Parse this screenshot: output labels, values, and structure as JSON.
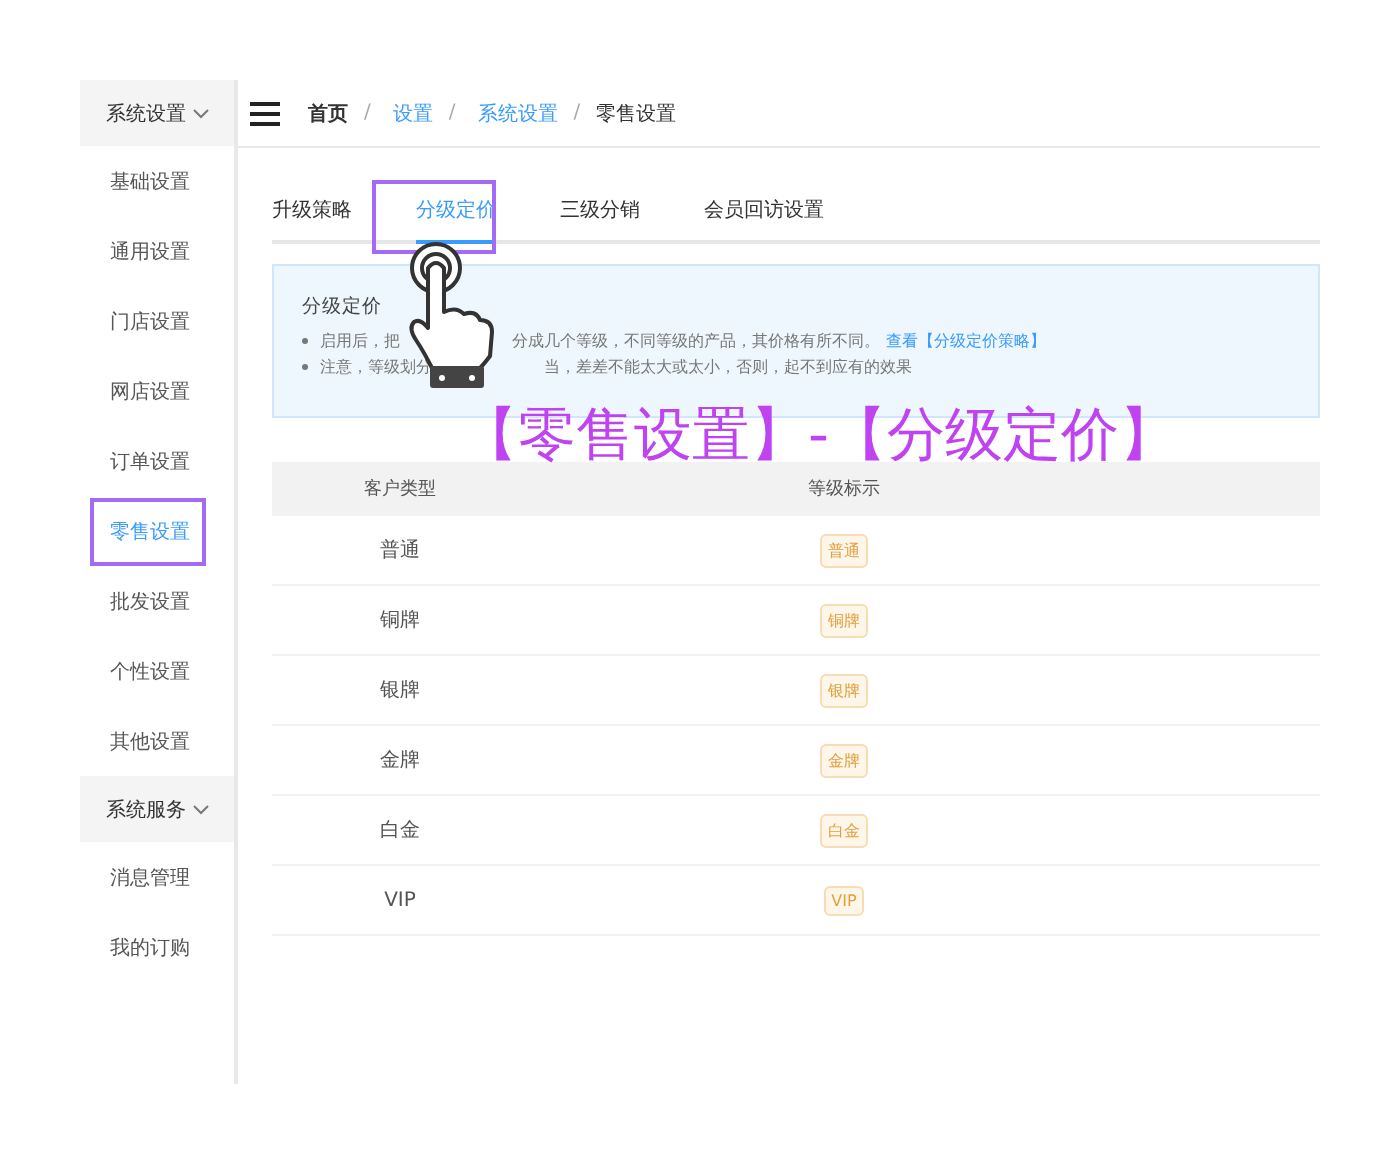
{
  "sidebar": {
    "groups": [
      {
        "title": "系统设置",
        "expanded": true,
        "items": [
          {
            "label": "基础设置",
            "selected": false
          },
          {
            "label": "通用设置",
            "selected": false
          },
          {
            "label": "门店设置",
            "selected": false
          },
          {
            "label": "网店设置",
            "selected": false
          },
          {
            "label": "订单设置",
            "selected": false
          },
          {
            "label": "零售设置",
            "selected": true
          },
          {
            "label": "批发设置",
            "selected": false
          },
          {
            "label": "个性设置",
            "selected": false
          },
          {
            "label": "其他设置",
            "selected": false
          }
        ]
      },
      {
        "title": "系统服务",
        "expanded": true,
        "items": [
          {
            "label": "消息管理",
            "selected": false
          },
          {
            "label": "我的订购",
            "selected": false
          }
        ]
      }
    ]
  },
  "breadcrumb": [
    {
      "label": "首页",
      "kind": "home"
    },
    {
      "separator": "/",
      "label": "设置",
      "kind": "link"
    },
    {
      "separator": "/",
      "label": "系统设置",
      "kind": "link"
    },
    {
      "separator": "/",
      "label": "零售设置",
      "kind": "current"
    }
  ],
  "tabs": [
    {
      "label": "升级策略",
      "selected": false
    },
    {
      "label": "分级定价",
      "selected": true
    },
    {
      "label": "三级分销",
      "selected": false
    },
    {
      "label": "会员回访设置",
      "selected": false
    }
  ],
  "notice": {
    "title": "分级定价",
    "lines": [
      {
        "before": "启用后，把",
        "after": "分成几个等级，不同等级的产品，其价格有所不同。",
        "link": "查看【分级定价策略】"
      },
      {
        "before": "注意，等级划分",
        "after": "当，差差不能太大或太小，否则，起不到应有的效果"
      }
    ]
  },
  "table": {
    "columns": [
      "客户类型",
      "等级标示"
    ],
    "rows": [
      {
        "type": "普通",
        "tag": "普通"
      },
      {
        "type": "铜牌",
        "tag": "铜牌"
      },
      {
        "type": "银牌",
        "tag": "银牌"
      },
      {
        "type": "金牌",
        "tag": "金牌"
      },
      {
        "type": "白金",
        "tag": "白金"
      },
      {
        "type": "VIP",
        "tag": "VIP"
      }
    ]
  },
  "annotation": {
    "caption": "【零售设置】-【分级定价】"
  }
}
